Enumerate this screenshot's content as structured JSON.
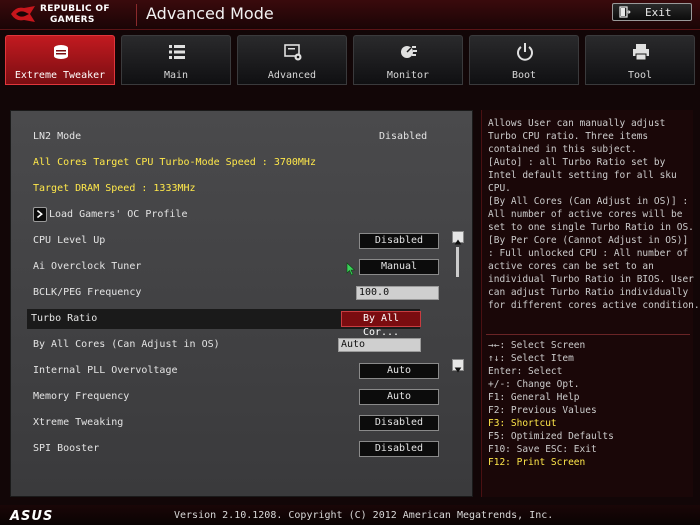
{
  "header": {
    "brand_line1": "REPUBLIC OF",
    "brand_line2": "GAMERS",
    "mode_title": "Advanced Mode",
    "exit_label": "Exit"
  },
  "tabs": [
    {
      "label": "Extreme Tweaker",
      "icon": "extreme-tweaker-icon",
      "active": true
    },
    {
      "label": "Main",
      "icon": "list-icon",
      "active": false
    },
    {
      "label": "Advanced",
      "icon": "advanced-icon",
      "active": false
    },
    {
      "label": "Monitor",
      "icon": "monitor-gauge-icon",
      "active": false
    },
    {
      "label": "Boot",
      "icon": "power-icon",
      "active": false
    },
    {
      "label": "Tool",
      "icon": "printer-icon",
      "active": false
    }
  ],
  "settings": {
    "ln2_mode": {
      "label": "LN2 Mode",
      "value": "Disabled"
    },
    "turbo_speed": {
      "label": "All Cores Target CPU Turbo-Mode Speed : 3700MHz"
    },
    "dram_speed": {
      "label": "Target DRAM Speed : 1333MHz"
    },
    "oc_profile": {
      "label": "Load Gamers' OC Profile"
    },
    "cpu_level_up": {
      "label": "CPU Level Up",
      "value": "Disabled"
    },
    "ai_overclock": {
      "label": "Ai Overclock Tuner",
      "value": "Manual"
    },
    "bclk": {
      "label": "BCLK/PEG Frequency",
      "value": "100.0"
    },
    "turbo_ratio": {
      "label": "Turbo Ratio",
      "value": "By All Cor..."
    },
    "by_all_cores": {
      "label": "By All Cores (Can Adjust in OS)",
      "value": "Auto"
    },
    "pll_overvoltage": {
      "label": "Internal PLL Overvoltage",
      "value": "Auto"
    },
    "memory_freq": {
      "label": "Memory Frequency",
      "value": "Auto"
    },
    "xtreme_tweaking": {
      "label": "Xtreme Tweaking",
      "value": "Disabled"
    },
    "spi_booster": {
      "label": "SPI Booster",
      "value": "Disabled"
    }
  },
  "help": {
    "description": "Allows User can manually adjust\nTurbo CPU ratio. Three items\ncontained in this subject.\n[Auto] : all Turbo Ratio set by\nIntel default setting for all sku\nCPU.\n[By All Cores (Can Adjust in OS)] :\nAll number of active cores will be\nset to one single Turbo Ratio in OS.\n[By Per Core (Cannot Adjust in OS)]\n: Full unlocked CPU : All number of\nactive cores can be set to an\nindividual Turbo Ratio in BIOS. User\ncan adjust Turbo Ratio individually\nfor different cores active condition.",
    "keys": [
      {
        "text": "→←: Select Screen",
        "highlight": false
      },
      {
        "text": "↑↓: Select Item",
        "highlight": false
      },
      {
        "text": "Enter: Select",
        "highlight": false
      },
      {
        "text": "+/-: Change Opt.",
        "highlight": false
      },
      {
        "text": "F1: General Help",
        "highlight": false
      },
      {
        "text": "F2: Previous Values",
        "highlight": false
      },
      {
        "text": "F3: Shortcut",
        "highlight": true
      },
      {
        "text": "F5: Optimized Defaults",
        "highlight": false
      },
      {
        "text": "F10: Save  ESC: Exit",
        "highlight": false
      },
      {
        "text": "F12: Print Screen",
        "highlight": true
      }
    ]
  },
  "footer": {
    "brand": "ASUS",
    "version": "Version 2.10.1208. Copyright (C) 2012 American Megatrends, Inc."
  },
  "colors": {
    "accent_red": "#c21a20",
    "highlight_yellow": "#ffe84a",
    "panel_gray": "#4a4a4c"
  }
}
